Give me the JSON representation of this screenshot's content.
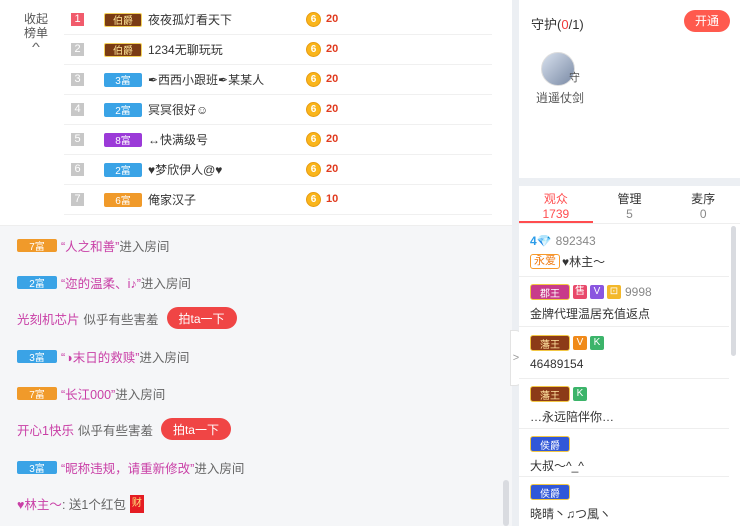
{
  "rank": {
    "collapse_label_1": "收起",
    "collapse_label_2": "榜单",
    "rows": [
      {
        "rank": "1",
        "badge": "伯爵",
        "name": "夜夜孤灯看天下",
        "coin": "6",
        "score": "20"
      },
      {
        "rank": "2",
        "badge": "伯爵",
        "name": "1234无聊玩玩",
        "coin": "6",
        "score": "20"
      },
      {
        "rank": "3",
        "badge": "3富",
        "name": "✒西西小跟班✒某某人",
        "coin": "6",
        "score": "20"
      },
      {
        "rank": "4",
        "badge": "2富",
        "name": "冥冥很好☺",
        "coin": "6",
        "score": "20"
      },
      {
        "rank": "5",
        "badge": "8富",
        "name": "↔快满级号",
        "coin": "6",
        "score": "20"
      },
      {
        "rank": "6",
        "badge": "2富",
        "name": "♥梦欣伊人@♥",
        "coin": "6",
        "score": "20"
      },
      {
        "rank": "7",
        "badge": "6富",
        "name": "俺家汉子",
        "coin": "6",
        "score": "10"
      }
    ]
  },
  "chat": {
    "m1": {
      "badge": "7富",
      "name": "“人之和善”",
      "text": "进入房间"
    },
    "m2": {
      "badge": "2富",
      "name": "“迩的温柔、i♪”",
      "text": "进入房间"
    },
    "m3": {
      "user": "光刻机芯片",
      "text": "似乎有些害羞",
      "button": "拍ta一下"
    },
    "m4": {
      "badge": "3富",
      "name": "“◑末日的救赎”",
      "text": "进入房间"
    },
    "m5": {
      "badge": "7富",
      "name": "“长江000”",
      "text": "进入房间"
    },
    "m6": {
      "user": "开心1快乐",
      "text": "似乎有些害羞",
      "button": "拍ta一下"
    },
    "m7": {
      "badge": "3富",
      "name": "“昵称违规，请重新修改”",
      "text": "进入房间"
    },
    "m8": {
      "user": "♥林主～",
      "text": ": 送1个红包",
      "gift": "财"
    }
  },
  "guard": {
    "title": "守护",
    "count_open": "(",
    "count": "0",
    "count_close": "/1)",
    "open_button": "开通",
    "avatar_tag": "守",
    "member_name": "逍遥仗剑"
  },
  "audience": {
    "tabs": [
      {
        "label": "观众",
        "count": "1739"
      },
      {
        "label": "管理",
        "count": "5"
      },
      {
        "label": "麦序",
        "count": "0"
      }
    ],
    "u1": {
      "level": "4",
      "level_icon": "💎",
      "id": "892343",
      "fan": "永爱",
      "name": "♥林主～"
    },
    "u2": {
      "crown": "郡王",
      "s1": "售",
      "s2": "V",
      "s3": "⊡",
      "id": "9998",
      "desc": "金牌代理温居充值返点"
    },
    "u3": {
      "crown": "藩王",
      "s1": "V",
      "s2": "K",
      "id": "46489154"
    },
    "u4": {
      "crown": "藩王",
      "s1": "K",
      "desc": "…永远陪伴你…"
    },
    "u5": {
      "crown": "侯爵",
      "desc": "大叔～^_^"
    },
    "u6": {
      "crown": "侯爵",
      "desc": "晓晴丶♫つ風ヽ"
    }
  },
  "handle_icon": "chevron-right"
}
